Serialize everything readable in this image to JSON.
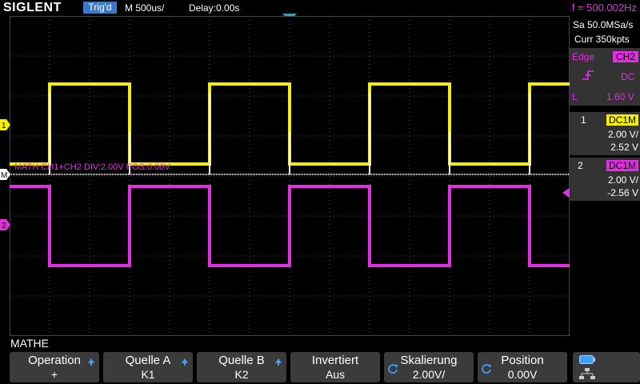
{
  "header": {
    "logo": "SIGLENT",
    "trigger_status": "Trig'd",
    "timebase": "M 500us/",
    "delay": "Delay:0.00s",
    "frequency": "f = 500.002Hz"
  },
  "acquisition": {
    "sample_rate": "Sa 50.0MSa/s",
    "memory_depth": "Curr 350kpts"
  },
  "trigger": {
    "type": "Edge",
    "source": "CH2",
    "coupling": "DC",
    "mode": "L",
    "level": "1.60 V"
  },
  "channels": [
    {
      "index": "1",
      "coupling": "DC1M",
      "scale": "2.00 V/",
      "offset": "2.52 V",
      "color": "#f4f000"
    },
    {
      "index": "2",
      "coupling": "DC1M",
      "scale": "2.00 V/",
      "offset": "-2.56 V",
      "color": "#e22fe2"
    }
  ],
  "markers": {
    "ch1": "1",
    "ch2": "2",
    "math": "M"
  },
  "math_label": "MATH   CH1+CH2   DIV:2.00V   POS:0.00V",
  "menu": {
    "title": "MATHE",
    "buttons": [
      {
        "label": "Operation",
        "value": "+"
      },
      {
        "label": "Quelle A",
        "value": "K1"
      },
      {
        "label": "Quelle B",
        "value": "K2"
      },
      {
        "label": "Invertiert",
        "value": "Aus"
      },
      {
        "label": "Skalierung",
        "value": "2.00V/"
      },
      {
        "label": "Position",
        "value": "0.00V"
      }
    ]
  },
  "colors": {
    "ch1": "#f4f000",
    "ch2": "#e22fe2",
    "math": "#ffffff",
    "accent": "#3a78c8"
  }
}
